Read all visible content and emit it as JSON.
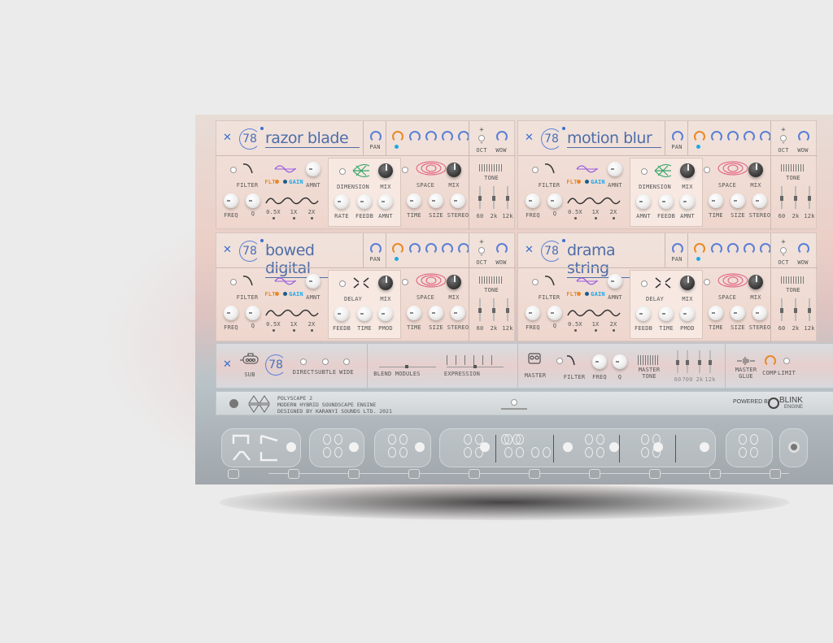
{
  "modules": [
    {
      "name": "razor blade",
      "value": "78",
      "fx_a": {
        "label": "DIMENSION",
        "knobs": [
          "RATE",
          "FEEDB",
          "AMNT"
        ]
      },
      "fx_b": {
        "label": "SPACE",
        "knobs": [
          "TIME",
          "SIZE",
          "STEREO"
        ]
      }
    },
    {
      "name": "motion blur",
      "value": "78",
      "fx_a": {
        "label": "DIMENSION",
        "knobs": [
          "AMNT",
          "FEEDB",
          "AMNT"
        ]
      },
      "fx_b": {
        "label": "SPACE",
        "knobs": [
          "TIME",
          "SIZE",
          "STEREO"
        ]
      }
    },
    {
      "name": "bowed digital",
      "value": "78",
      "fx_a": {
        "label": "DELAY",
        "knobs": [
          "FEEDB",
          "TIME",
          "PMOD"
        ]
      },
      "fx_b": {
        "label": "SPACE",
        "knobs": [
          "TIME",
          "SIZE",
          "STEREO"
        ]
      }
    },
    {
      "name": "drama string",
      "value": "78",
      "fx_a": {
        "label": "DELAY",
        "knobs": [
          "FEEDB",
          "TIME",
          "PMOD"
        ]
      },
      "fx_b": {
        "label": "SPACE",
        "knobs": [
          "TIME",
          "SIZE",
          "STEREO"
        ]
      }
    }
  ],
  "common": {
    "pan": "PAN",
    "oct": "OCT",
    "wow": "WOW",
    "oct_plus": "+",
    "oct_minus": "-",
    "filter": "FILTER",
    "freq": "FREQ",
    "q": "Q",
    "flt": "FLT",
    "gain": "GAIN",
    "amnt": "AMNT",
    "rates": [
      "0.5X",
      "1X",
      "2X"
    ],
    "mix": "MIX",
    "tone": "TONE",
    "tone_bands": [
      "60",
      "2k",
      "12k"
    ]
  },
  "global": {
    "sub": "SUB",
    "value": "78",
    "modes": [
      "DIRECT",
      "SUBTLE",
      "WIDE"
    ],
    "blend": "BLEND MODULES",
    "expression": "EXPRESSION",
    "master": "MASTER",
    "filter": "FILTER",
    "freq": "FREQ",
    "q": "Q",
    "master_tone": "MASTER TONE",
    "eq_bands": [
      "60",
      "700",
      "2k",
      "12k"
    ],
    "master_glue": "MASTER GLUE",
    "comp": "COMP",
    "limit": "LIMIT"
  },
  "info": {
    "line1": "POLYSCAPE 2",
    "line2": "MODERN HYBRID SOUNDSCAPE ENGINE",
    "line3": "DESIGNED BY KARANYI SOUNDS LTD. 2021",
    "powered": "POWERED BY",
    "brand": "BLINK",
    "brand_sub": "ENGINE"
  },
  "colors": {
    "accent": "#3a6fd0",
    "orange": "#e8892a",
    "cyan": "#1fa6e8"
  }
}
